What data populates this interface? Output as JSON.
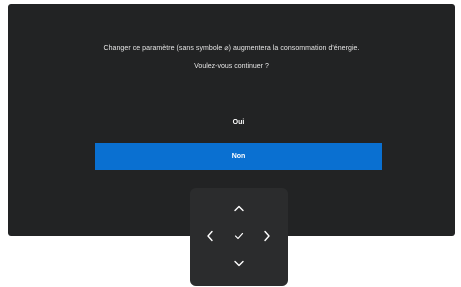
{
  "dialog": {
    "message": "Changer ce paramètre (sans symbole ⌀) augmentera la consommation d'énergie.",
    "question": "Voulez-vous continuer ?",
    "options": [
      {
        "label": "Oui",
        "selected": false
      },
      {
        "label": "Non",
        "selected": true
      }
    ]
  },
  "navigation": {
    "buttons": [
      "chevron-up-icon",
      "chevron-left-icon",
      "checkmark-icon",
      "chevron-right-icon",
      "chevron-down-icon"
    ]
  },
  "colors": {
    "panel_background": "#222324",
    "selected_option": "#0a70d1",
    "nav_background": "#2b2c2d"
  }
}
